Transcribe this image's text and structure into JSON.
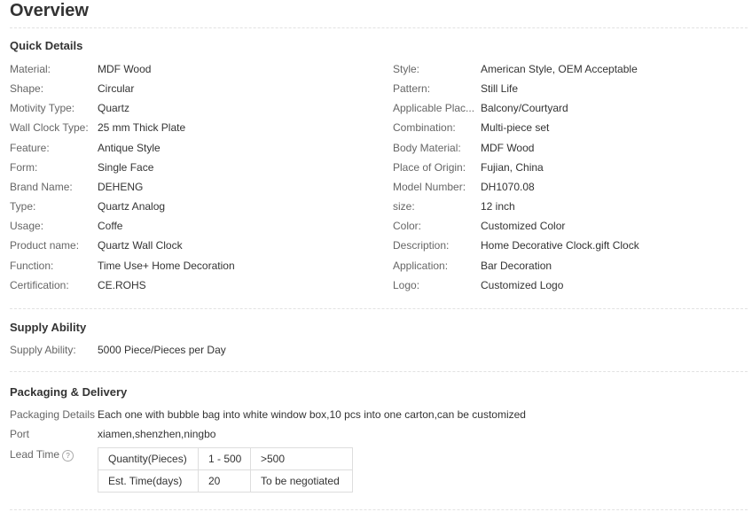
{
  "page_title": "Overview",
  "quick_details": {
    "title": "Quick Details",
    "left": [
      {
        "label": "Material:",
        "value": "MDF Wood"
      },
      {
        "label": "Shape:",
        "value": "Circular"
      },
      {
        "label": "Motivity Type:",
        "value": "Quartz"
      },
      {
        "label": "Wall Clock Type:",
        "value": "25 mm Thick Plate"
      },
      {
        "label": "Feature:",
        "value": "Antique Style"
      },
      {
        "label": "Form:",
        "value": "Single Face"
      },
      {
        "label": "Brand Name:",
        "value": "DEHENG"
      },
      {
        "label": "Type:",
        "value": "Quartz Analog"
      },
      {
        "label": "Usage:",
        "value": "Coffe"
      },
      {
        "label": "Product name:",
        "value": "Quartz Wall Clock"
      },
      {
        "label": "Function:",
        "value": "Time Use+ Home Decoration"
      },
      {
        "label": "Certification:",
        "value": "CE.ROHS"
      }
    ],
    "right": [
      {
        "label": "Style:",
        "value": "American Style, OEM Acceptable"
      },
      {
        "label": "Pattern:",
        "value": "Still Life"
      },
      {
        "label": "Applicable Plac...",
        "value": "Balcony/Courtyard"
      },
      {
        "label": "Combination:",
        "value": "Multi-piece set"
      },
      {
        "label": "Body Material:",
        "value": "MDF Wood"
      },
      {
        "label": "Place of Origin:",
        "value": "Fujian, China"
      },
      {
        "label": "Model Number:",
        "value": "DH1070.08"
      },
      {
        "label": "size:",
        "value": "12 inch"
      },
      {
        "label": "Color:",
        "value": "Customized Color"
      },
      {
        "label": "Description:",
        "value": "Home Decorative Clock.gift Clock"
      },
      {
        "label": "Application:",
        "value": "Bar Decoration"
      },
      {
        "label": "Logo:",
        "value": "Customized Logo"
      }
    ]
  },
  "supply_ability": {
    "title": "Supply Ability",
    "label": "Supply Ability:",
    "value": "5000 Piece/Pieces per Day"
  },
  "packaging": {
    "title": "Packaging & Delivery",
    "details_label": "Packaging Details",
    "details_value": "Each one with bubble bag into white window box,10 pcs into one carton,can be customized",
    "port_label": "Port",
    "port_value": "xiamen,shenzhen,ningbo",
    "lead_time_label": "Lead Time",
    "help_icon_glyph": "?",
    "lead_table": {
      "row1": [
        "Quantity(Pieces)",
        "1 - 500",
        ">500"
      ],
      "row2": [
        "Est. Time(days)",
        "20",
        "To be negotiated"
      ]
    }
  }
}
